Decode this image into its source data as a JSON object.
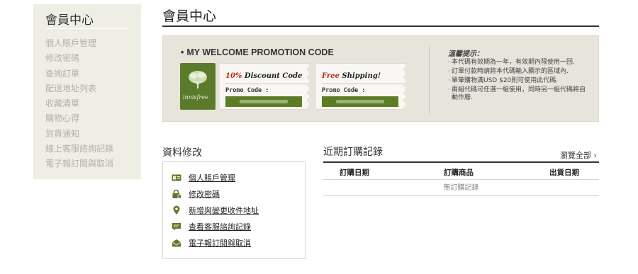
{
  "sidebar": {
    "title": "會員中心",
    "items": [
      "個人賬戶管理",
      "修改密碼",
      "查詢訂單",
      "配送地址列表",
      "收藏清單",
      "購物心得",
      "到貨通知",
      "線上客服諮詢記錄",
      "電子報訂閱與取消"
    ]
  },
  "page": {
    "title": "會員中心"
  },
  "promo": {
    "heading": "MY WELCOME PROMOTION CODE",
    "bullet": "•",
    "logo_text": "innisfree",
    "coupons": [
      {
        "title_highlight": "10%",
        "title_rest": " Discount Code",
        "code_label": "Promo Code :"
      },
      {
        "title_highlight": "Free",
        "title_rest": " Shipping!",
        "code_label": "Promo Code :"
      }
    ],
    "notice_title": "溫馨提示：",
    "notices": [
      "本代碼有效期為一年，有效期內限使用一回.",
      "訂單付款時請將本代碼輸入顯示的區域內.",
      "單筆購物滿USD $20則可使用此代碼.",
      "兩組代碼可任選一組使用，同時另一組代碼將自動作廢."
    ]
  },
  "account": {
    "title": "資料修改",
    "links": [
      {
        "label": "個人賬戶管理",
        "icon": "id-card-icon"
      },
      {
        "label": "修改密碼",
        "icon": "lock-icon"
      },
      {
        "label": "新增與變更收件地址",
        "icon": "map-pin-icon"
      },
      {
        "label": "查看客服諮詢記錄",
        "icon": "chat-bubble-icon"
      },
      {
        "label": "電子報訂閱與取消",
        "icon": "envelope-icon"
      }
    ]
  },
  "orders": {
    "title": "近期訂購記錄",
    "view_all": "瀏覽全部 ›",
    "columns": [
      "訂購日期",
      "訂購商品",
      "出貨日期"
    ],
    "empty": "無訂購記錄"
  },
  "colors": {
    "accent_green": "#5e7b26",
    "red": "#c0281a",
    "sidebar_bg": "#eeeee4",
    "promo_bg": "#e7e4db"
  }
}
